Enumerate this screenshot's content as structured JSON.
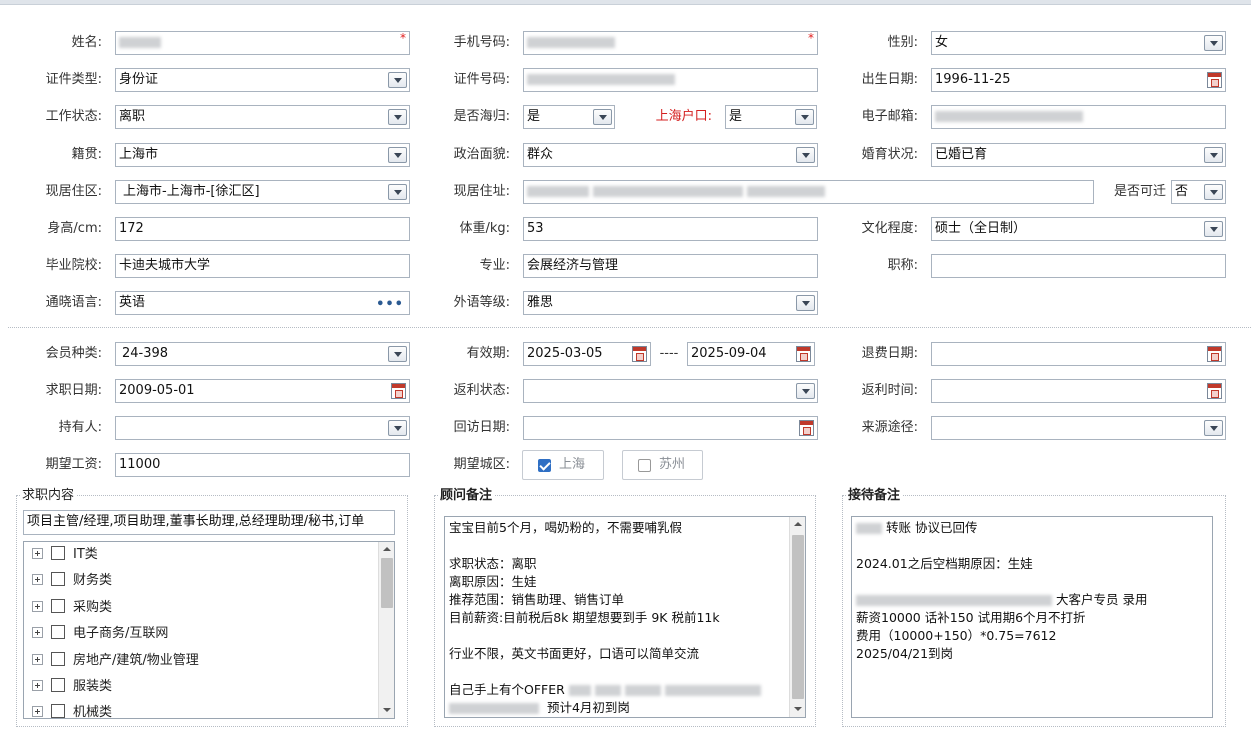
{
  "form": {
    "name": {
      "label": "姓名:"
    },
    "phone": {
      "label": "手机号码:"
    },
    "gender": {
      "label": "性别:",
      "value": "女"
    },
    "id_type": {
      "label": "证件类型:",
      "value": "身份证"
    },
    "id_no": {
      "label": "证件号码:"
    },
    "birth": {
      "label": "出生日期:",
      "value": "1996-11-25"
    },
    "work_status": {
      "label": "工作状态:",
      "value": "离职"
    },
    "returnee": {
      "label": "是否海归:",
      "value": "是"
    },
    "sh_hukou": {
      "label": "上海户口:",
      "value": "是"
    },
    "email": {
      "label": "电子邮箱:"
    },
    "native": {
      "label": "籍贯:",
      "value": "上海市"
    },
    "politics": {
      "label": "政治面貌:",
      "value": "群众"
    },
    "marital": {
      "label": "婚育状况:",
      "value": "已婚已育"
    },
    "residence_area": {
      "label": "现居住区:",
      "value": "上海市-上海市-[徐汇区]"
    },
    "address": {
      "label": "现居住址:"
    },
    "relocate": {
      "label": "是否可迁",
      "value": "否"
    },
    "height": {
      "label": "身高/cm:",
      "value": "172"
    },
    "weight": {
      "label": "体重/kg:",
      "value": "53"
    },
    "education": {
      "label": "文化程度:",
      "value": "硕士（全日制）"
    },
    "school": {
      "label": "毕业院校:",
      "value": "卡迪夫城市大学"
    },
    "major": {
      "label": "专业:",
      "value": "会展经济与管理"
    },
    "title": {
      "label": "职称:",
      "value": ""
    },
    "language": {
      "label": "通晓语言:",
      "value": "英语"
    },
    "lang_level": {
      "label": "外语等级:",
      "value": "雅思"
    },
    "member_type": {
      "label": "会员种类:",
      "value": "24-398"
    },
    "valid": {
      "label": "有效期:",
      "from": "2025-03-05",
      "sep": "----",
      "to": "2025-09-04"
    },
    "refund_date": {
      "label": "退费日期:",
      "value": ""
    },
    "job_date": {
      "label": "求职日期:",
      "value": "2009-05-01"
    },
    "rebate_status": {
      "label": "返利状态:",
      "value": ""
    },
    "rebate_time": {
      "label": "返利时间:",
      "value": ""
    },
    "holder": {
      "label": "持有人:",
      "value": ""
    },
    "visit_date": {
      "label": "回访日期:",
      "value": ""
    },
    "source": {
      "label": "来源途径:",
      "value": ""
    },
    "salary": {
      "label": "期望工资:",
      "value": "11000"
    },
    "city": {
      "label": "期望城区:",
      "options": [
        {
          "label": "上海",
          "checked": true
        },
        {
          "label": "苏州",
          "checked": false
        }
      ]
    }
  },
  "job_content": {
    "title": "求职内容",
    "summary": "项目主管/经理,项目助理,董事长助理,总经理助理/秘书,订单",
    "categories": [
      "IT类",
      "财务类",
      "采购类",
      "电子商务/互联网",
      "房地产/建筑/物业管理",
      "服装类",
      "机械类"
    ]
  },
  "advisor_notes": {
    "title": "顾问备注",
    "lines": [
      "宝宝目前5个月，喝奶粉的，不需要哺乳假",
      "",
      "求职状态：离职",
      "离职原因：生娃",
      "推荐范围：销售助理、销售订单",
      "目前薪资:目前税后8k  期望想要到手 9K 税前11k",
      "",
      "行业不限，英文书面更好，口语可以简单交流",
      "",
      "自己手上有个OFFER",
      "预计4月初到岗"
    ]
  },
  "reception_notes": {
    "title": "接待备注",
    "lines": [
      "转账 协议已回传",
      "",
      "2024.01之后空档期原因：生娃",
      "",
      "大客户专员 录用",
      "薪资10000 话补150 试用期6个月不打折",
      "费用（10000+150）*0.75=7612",
      " 2025/04/21到岗"
    ]
  }
}
